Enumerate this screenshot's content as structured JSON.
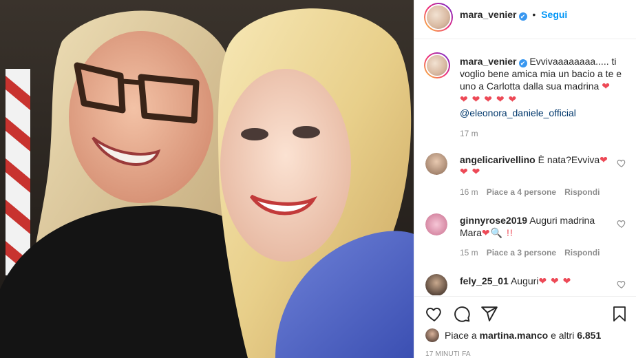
{
  "author": {
    "username": "mara_venier",
    "follow_label": "Segui",
    "verified_glyph": "✔"
  },
  "caption": {
    "username": "mara_venier",
    "text": "Evvivaaaaaaaa..... ti voglio bene amica mia un bacio a te e uno a Carlotta dalla sua madrina",
    "hearts": "❤ ❤ ❤ ❤ ❤",
    "end_heart": "❤",
    "mention": "@eleonora_daniele_official",
    "time": "17 m"
  },
  "comments": [
    {
      "username": "angelicarivellino",
      "text": "È nata?Evviva",
      "emoji": "❤",
      "emoji_line2": "❤ ❤",
      "time": "16 m",
      "likes": "Piace a 4 persone",
      "reply": "Rispondi"
    },
    {
      "username": "ginnyrose2019",
      "text": "Auguri madrina",
      "text2": "Mara",
      "emoji2": "❤🔍 !!",
      "time": "15 m",
      "likes": "Piace a 3 persone",
      "reply": "Rispondi"
    },
    {
      "username": "fely_25_01",
      "text": "Auguri",
      "emoji": "❤ ❤ ❤"
    }
  ],
  "likes": {
    "prefix": "Piace a",
    "user": "martina.manco",
    "middle": "e altri",
    "count": "6.851"
  },
  "timestamp": "17 minuti fa",
  "colors": {
    "accent": "#0095f6",
    "verified": "#3897f0",
    "heart": "#ed4956",
    "muted": "#8e8e8e"
  },
  "icons": [
    "heart-icon",
    "comment-icon",
    "share-icon",
    "bookmark-icon",
    "verified-icon",
    "like-comment-icon"
  ]
}
